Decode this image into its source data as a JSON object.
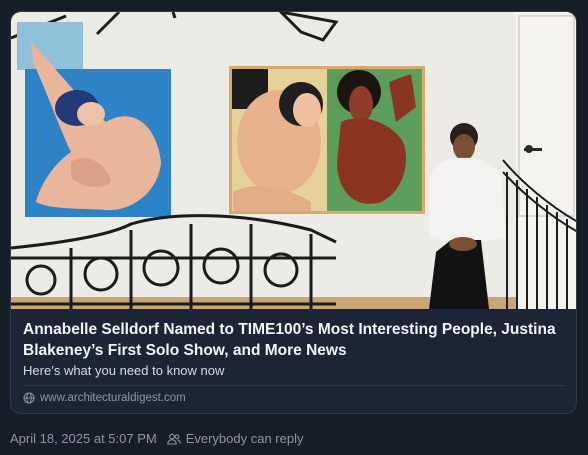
{
  "post": {
    "link_card": {
      "title": "Annabelle Selldorf Named to TIME100’s Most Interesting People, Justina Blakeney’s First Solo Show, and More News",
      "description": "Here’s what you need to know now",
      "domain": "www.architecturaldigest.com",
      "domain_icon": "globe-icon",
      "image_icon": "photo"
    },
    "timestamp": "April 18, 2025 at 5:07 PM",
    "reply_setting_icon": "people-icon",
    "reply_setting": "Everybody can reply"
  },
  "colors": {
    "background": "#151d28",
    "card_background": "#1b2535",
    "card_border": "#2e3a4b",
    "title_text": "#f3f5f8",
    "muted_text": "#8b97a8"
  }
}
